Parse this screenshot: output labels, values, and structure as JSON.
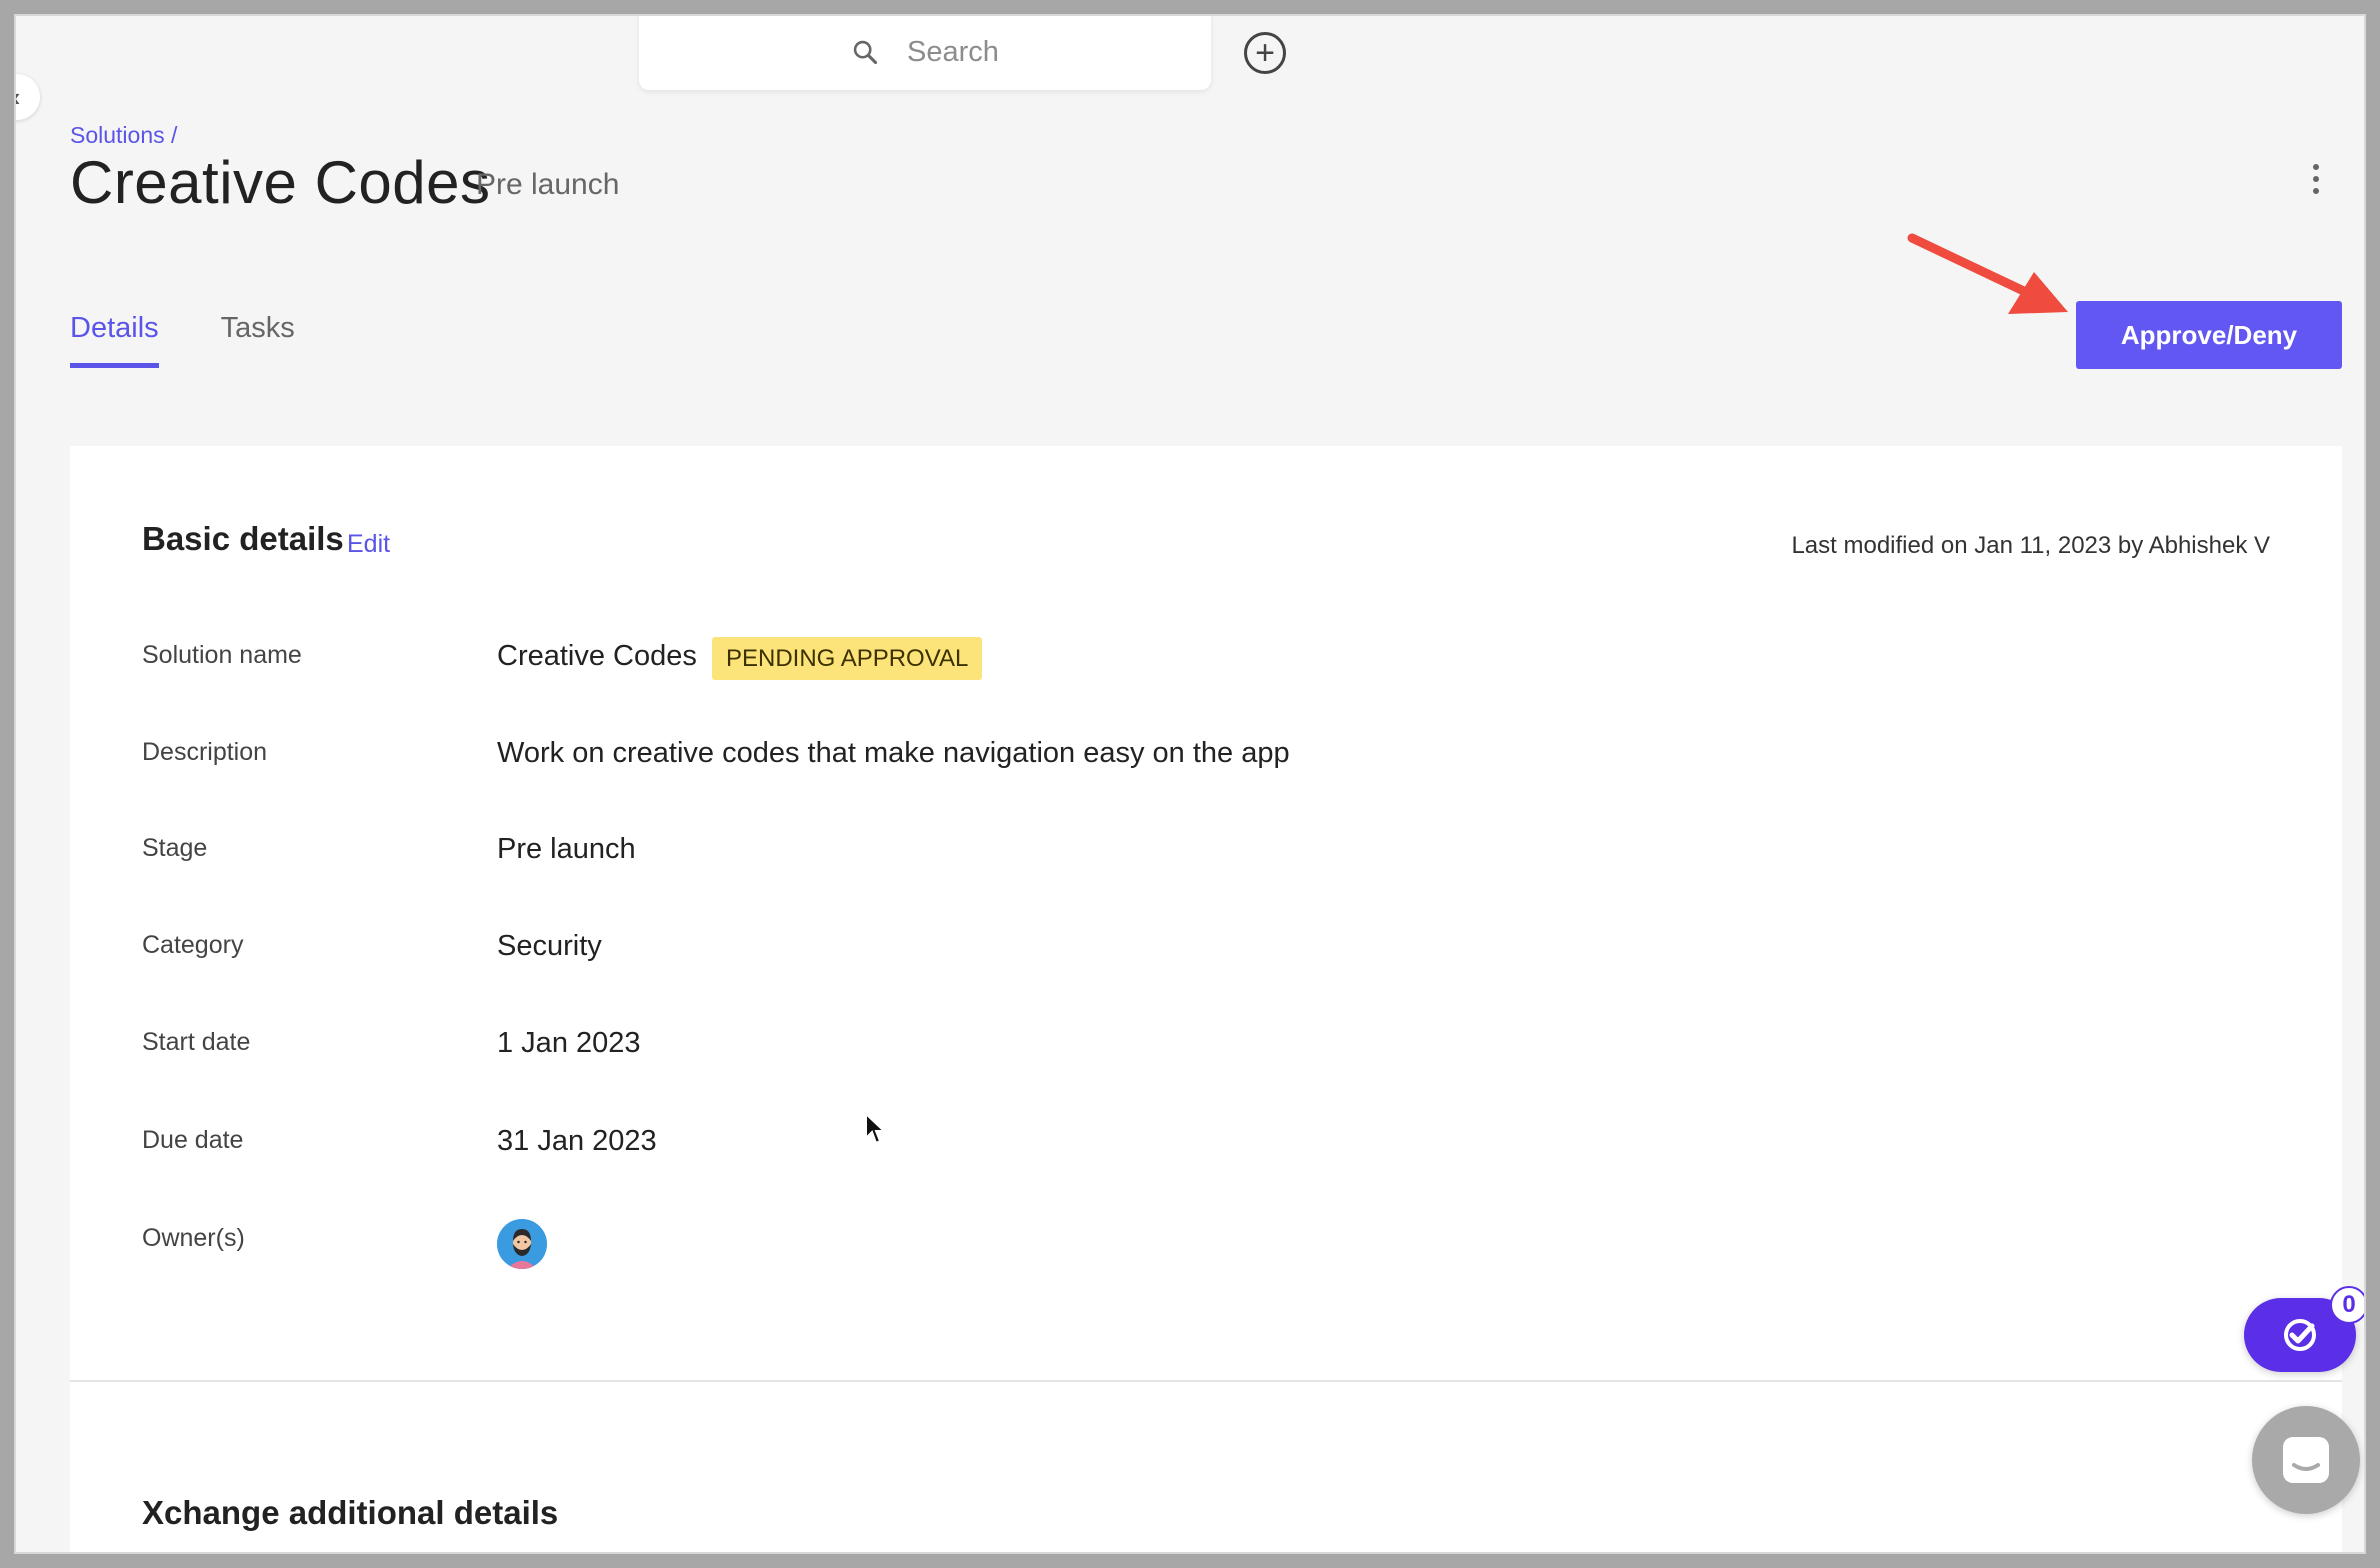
{
  "header": {
    "search_placeholder": "Search",
    "icons": {
      "search": "search-icon",
      "add": "plus-circle-icon",
      "more": "kebab-menu-icon"
    }
  },
  "page": {
    "breadcrumb": "Solutions /",
    "title": "Creative Codes",
    "stage": "Pre launch"
  },
  "tabs": [
    {
      "label": "Details",
      "active": true
    },
    {
      "label": "Tasks",
      "active": false
    }
  ],
  "actions": {
    "approve_label": "Approve/Deny"
  },
  "basic_details": {
    "title": "Basic details",
    "edit_label": "Edit",
    "last_modified": "Last modified on Jan 11, 2023 by Abhishek V",
    "fields": [
      {
        "label": "Solution name",
        "value": "Creative Codes",
        "badge": "PENDING APPROVAL"
      },
      {
        "label": "Description",
        "value": "Work on creative codes that make navigation easy on the app"
      },
      {
        "label": "Stage",
        "value": "Pre launch"
      },
      {
        "label": "Category",
        "value": "Security"
      },
      {
        "label": "Start date",
        "value": "1 Jan 2023"
      },
      {
        "label": "Due date",
        "value": "31 Jan 2023"
      },
      {
        "label": "Owner(s)",
        "value": ""
      }
    ]
  },
  "additional_details": {
    "title": "Xchange additional details"
  },
  "widgets": {
    "tasks_count": "0"
  },
  "colors": {
    "accent": "#6257f2",
    "badge": "#fde47a",
    "annotation_arrow": "#ef4b3f"
  }
}
